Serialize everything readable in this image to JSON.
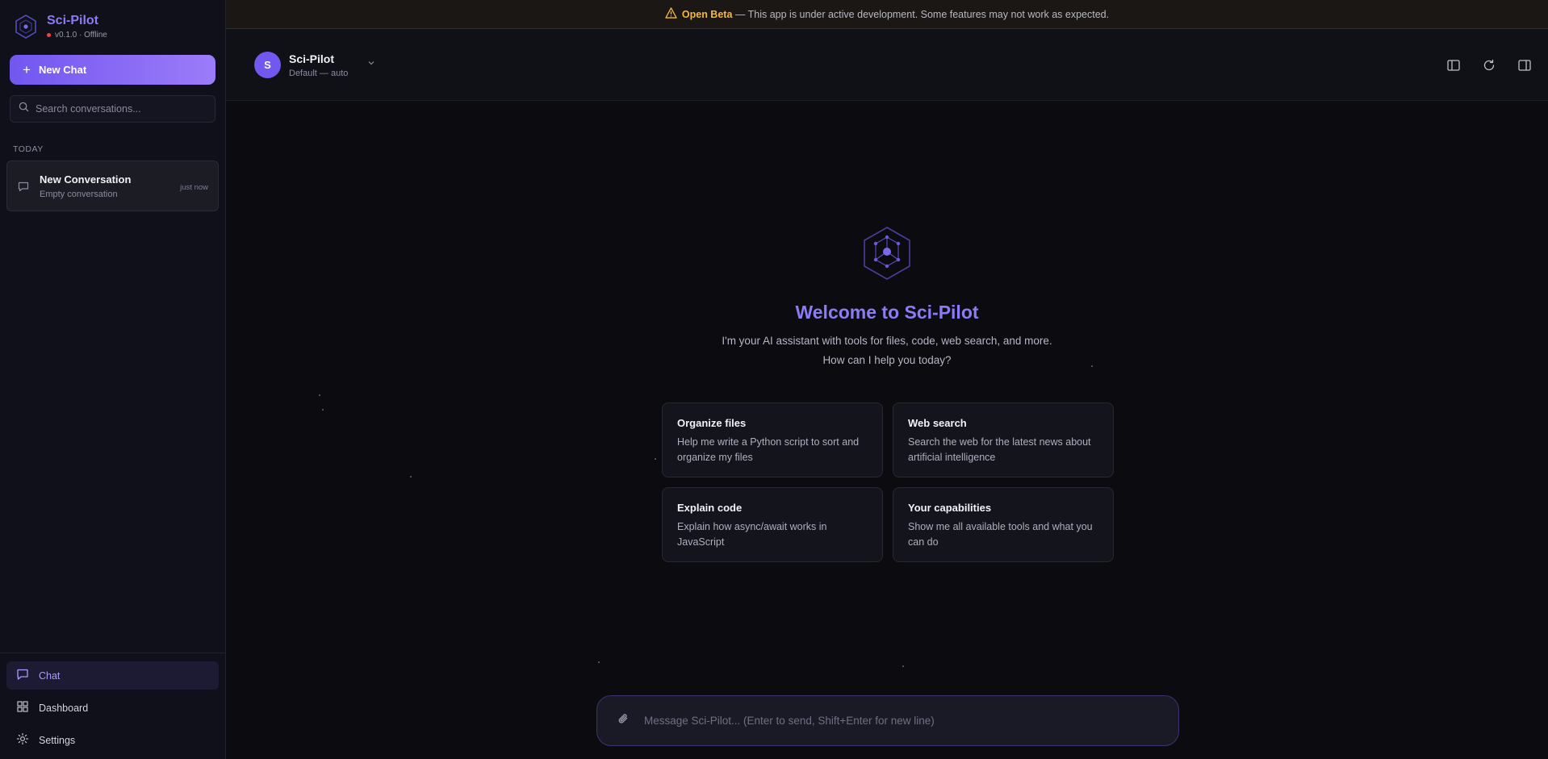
{
  "brand": {
    "name": "Sci-Pilot",
    "version_status": "v0.1.0 · Offline",
    "accent": "#8b7cf6",
    "status_color": "#ef4444"
  },
  "sidebar": {
    "new_chat_label": "New Chat",
    "search_placeholder": "Search conversations...",
    "section_today": "TODAY",
    "conversations": [
      {
        "title": "New Conversation",
        "subtitle": "Empty conversation",
        "time": "just now"
      }
    ],
    "nav": [
      {
        "label": "Chat",
        "icon": "chat-icon",
        "active": true
      },
      {
        "label": "Dashboard",
        "icon": "dashboard-icon",
        "active": false
      },
      {
        "label": "Settings",
        "icon": "gear-icon",
        "active": false
      }
    ]
  },
  "banner": {
    "icon": "warning-icon",
    "strong": "Open Beta",
    "text": " — This app is under active development. Some features may not work as expected.",
    "color": "#f5b841"
  },
  "header": {
    "avatar_letter": "S",
    "agent_name": "Sci-Pilot",
    "agent_mode": "Default — auto",
    "icons": [
      "sidebar-left-icon",
      "refresh-icon",
      "sidebar-right-icon"
    ]
  },
  "welcome": {
    "title": "Welcome to Sci-Pilot",
    "line1": "I'm your AI assistant with tools for files, code, web search, and more.",
    "line2": "How can I help you today?"
  },
  "suggestions": [
    {
      "title": "Organize files",
      "desc": "Help me write a Python script to sort and organize my files"
    },
    {
      "title": "Web search",
      "desc": "Search the web for the latest news about artificial intelligence"
    },
    {
      "title": "Explain code",
      "desc": "Explain how async/await works in JavaScript"
    },
    {
      "title": "Your capabilities",
      "desc": "Show me all available tools and what you can do"
    }
  ],
  "composer": {
    "placeholder": "Message Sci-Pilot... (Enter to send, Shift+Enter for new line)",
    "value": ""
  }
}
